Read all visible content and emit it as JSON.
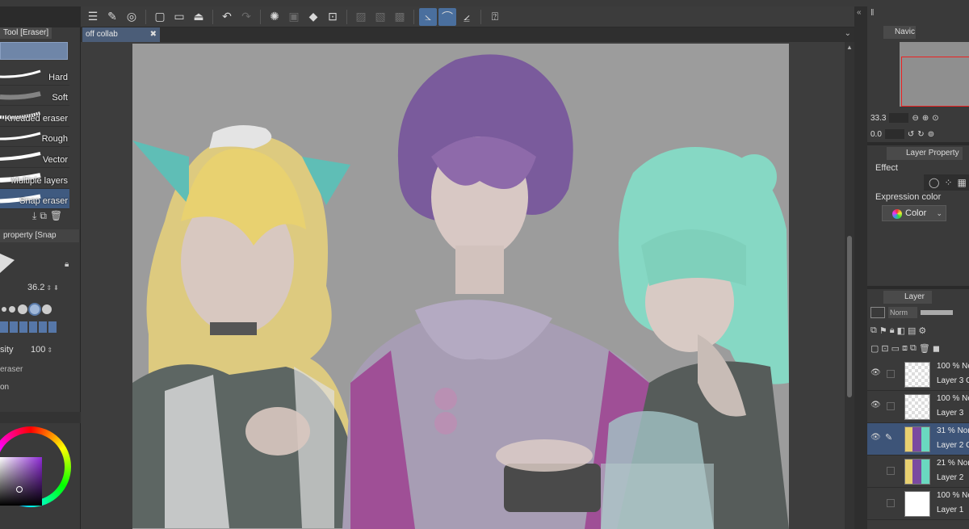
{
  "toolbar": {
    "buttons": [
      "menu-icon",
      "tool-icon",
      "swirl-icon",
      "new-icon",
      "open-icon",
      "save-icon",
      "undo-icon",
      "redo-icon",
      "clear-icon",
      "fill-icon",
      "transform-icon",
      "ruler-icon",
      "help-icon"
    ]
  },
  "tool_panel": {
    "tab_label": "Tool [Eraser]",
    "brushes": [
      {
        "label": "Hard",
        "selected": false
      },
      {
        "label": "Soft",
        "selected": false
      },
      {
        "label": "Kneaded eraser",
        "selected": false
      },
      {
        "label": "Rough",
        "selected": false
      },
      {
        "label": "Vector",
        "selected": false
      },
      {
        "label": "Multiple layers",
        "selected": false
      },
      {
        "label": "Snap eraser",
        "selected": true
      }
    ]
  },
  "tool_property": {
    "tab_label": "property [Snap",
    "size_value": "36.2",
    "density_label": "sity",
    "density_value": "100",
    "eraser_label": "eraser",
    "on_label": "on"
  },
  "document": {
    "tab_label": "off collab",
    "close_glyph": "✖"
  },
  "navigator": {
    "tab_label": "Navic",
    "zoom_value": "33.3",
    "angle_value": "0.0"
  },
  "layer_property": {
    "tab_label": "Layer Property",
    "effect_label": "Effect",
    "expression_label": "Expression color",
    "expression_value": "Color"
  },
  "layer_panel": {
    "tab_label": "Layer",
    "blend_mode": "Norm",
    "layers": [
      {
        "mode": "100 % No",
        "name": "Layer 3 C",
        "visible": true,
        "selected": false,
        "thumb": "checker"
      },
      {
        "mode": "100 % No",
        "name": "Layer 3",
        "visible": true,
        "selected": false,
        "thumb": "checker"
      },
      {
        "mode": "31 % Nor",
        "name": "Layer 2 C",
        "visible": true,
        "selected": true,
        "thumb": "art"
      },
      {
        "mode": "21 % Nor",
        "name": "Layer 2",
        "visible": false,
        "selected": false,
        "thumb": "art"
      },
      {
        "mode": "100 % No",
        "name": "Layer 1",
        "visible": false,
        "selected": false,
        "thumb": "white"
      }
    ]
  }
}
